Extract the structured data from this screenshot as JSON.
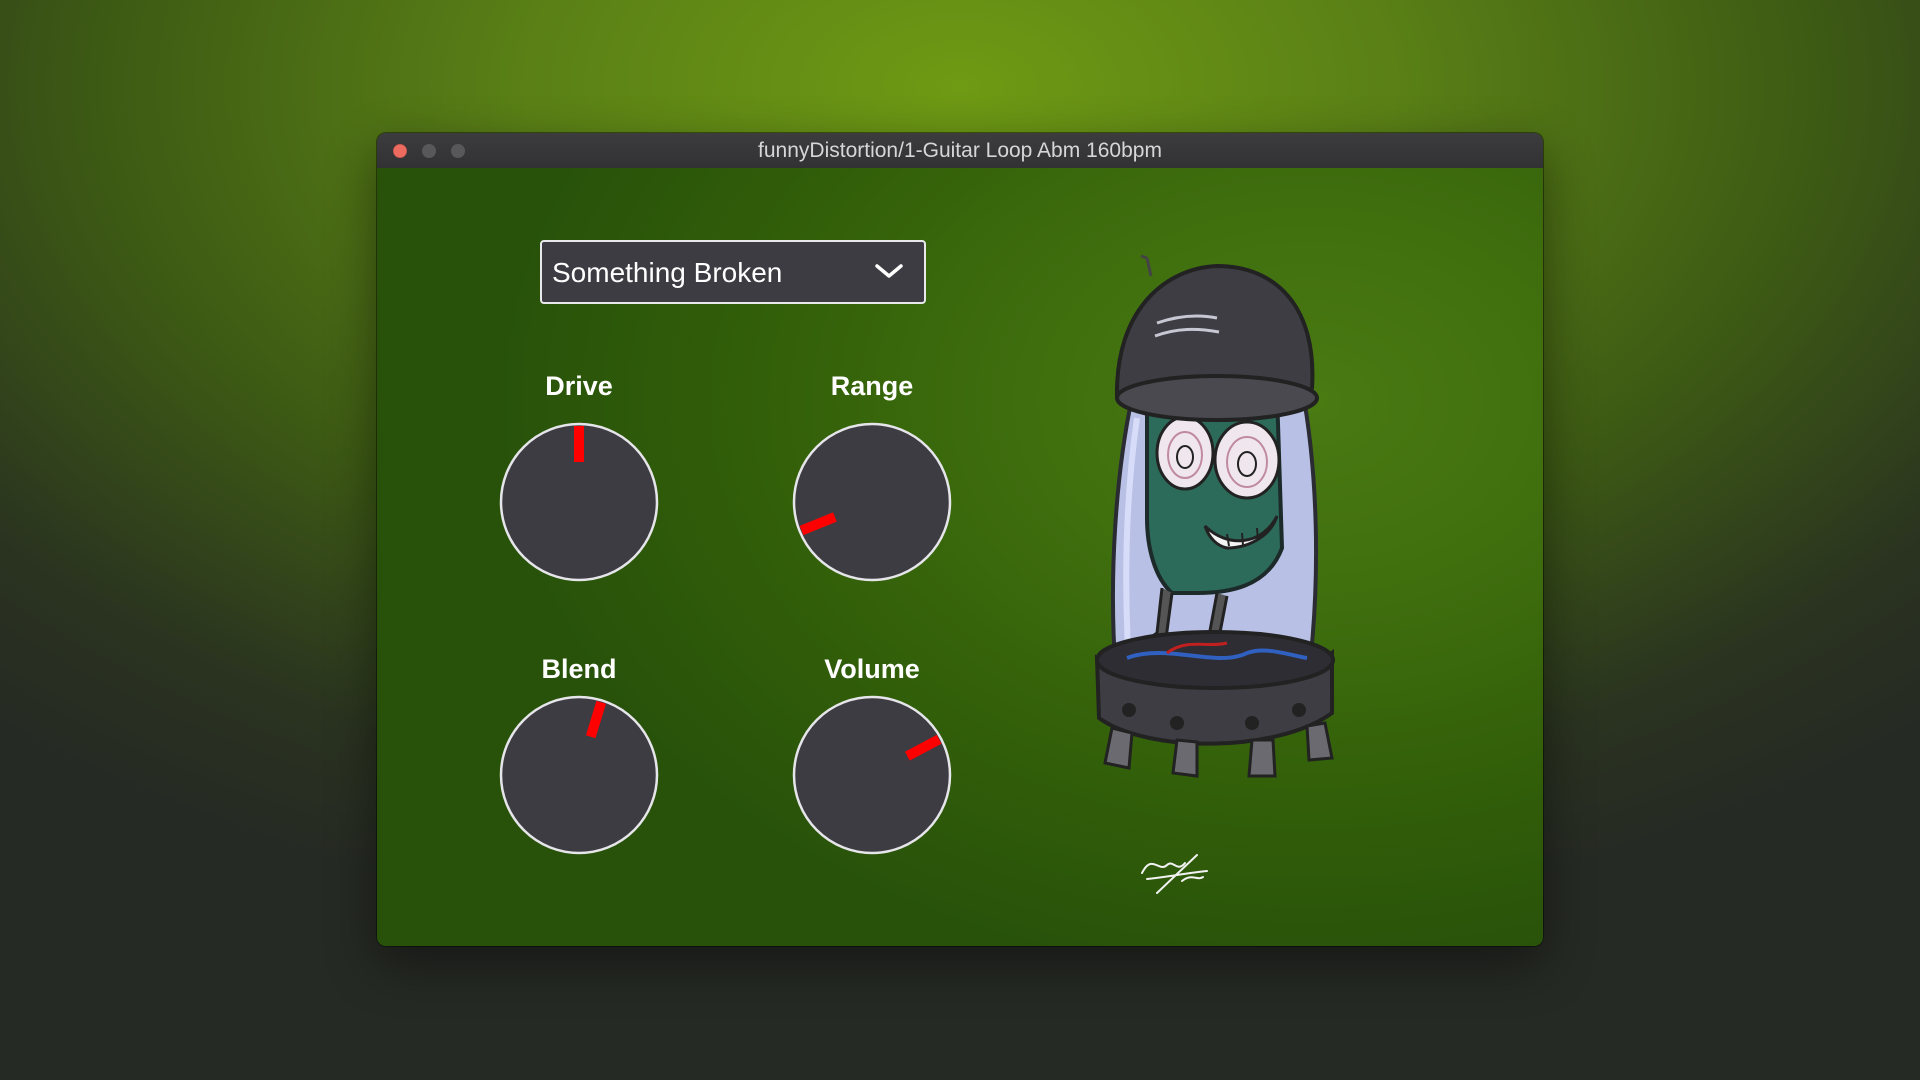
{
  "window": {
    "title": "funnyDistortion/1-Guitar Loop Abm 160bpm"
  },
  "preset": {
    "selected": "Something Broken",
    "icon": "chevron-down-icon"
  },
  "knobs": [
    {
      "id": "drive",
      "label": "Drive",
      "angle_deg": 0
    },
    {
      "id": "range",
      "label": "Range",
      "angle_deg": -112
    },
    {
      "id": "blend",
      "label": "Blend",
      "angle_deg": 17
    },
    {
      "id": "volume",
      "label": "Volume",
      "angle_deg": 62
    }
  ],
  "colors": {
    "knob_body": "#3d3c42",
    "knob_ring": "#e6e6ea",
    "indicator": "#ff0000",
    "close_button": "#ed6a5e"
  },
  "illustration": {
    "subject": "cartoon vacuum tube character",
    "icon": "vacuum-tube-character-illustration"
  }
}
